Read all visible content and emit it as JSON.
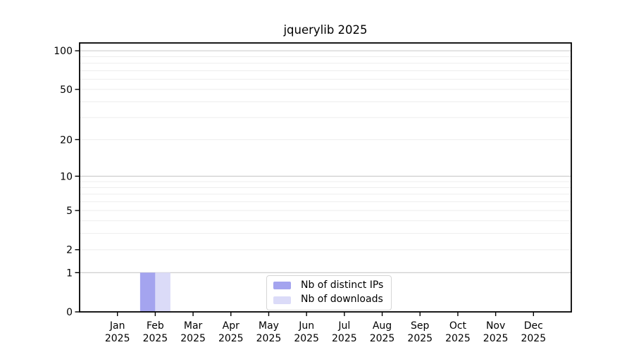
{
  "figure": {
    "background": "#ffffff"
  },
  "chart_data": {
    "type": "bar",
    "title": "jquerylib 2025",
    "categories": [
      "Jan",
      "Feb",
      "Mar",
      "Apr",
      "May",
      "Jun",
      "Jul",
      "Aug",
      "Sep",
      "Oct",
      "Nov",
      "Dec"
    ],
    "x_year_label": "2025",
    "series": [
      {
        "name": "Nb of distinct IPs",
        "color": "#a4a4ef",
        "values": [
          0,
          1,
          0,
          0,
          0,
          0,
          0,
          0,
          0,
          0,
          0,
          0
        ]
      },
      {
        "name": "Nb of downloads",
        "color": "#dbdbf8",
        "values": [
          0,
          1,
          0,
          0,
          0,
          0,
          0,
          0,
          0,
          0,
          0,
          0
        ]
      }
    ],
    "y_axis": {
      "scale": "log1p",
      "range": [
        0,
        115
      ],
      "tick_labels": [
        0,
        1,
        2,
        5,
        10,
        20,
        50,
        100
      ],
      "major_gridlines": [
        1,
        10,
        100
      ],
      "minor_gridlines": [
        2,
        3,
        4,
        5,
        6,
        7,
        8,
        9,
        20,
        30,
        40,
        50,
        60,
        70,
        80,
        90
      ]
    },
    "legend": {
      "position": "bottom-center",
      "entries": [
        {
          "label": "Nb of distinct IPs",
          "color": "#a4a4ef"
        },
        {
          "label": "Nb of downloads",
          "color": "#dbdbf8"
        }
      ]
    },
    "grid": true,
    "colors": {
      "axis": "#000000",
      "major_grid": "#c8c8c8",
      "minor_grid": "#ededed",
      "text": "#000000",
      "legend_border": "#d5d5d5"
    }
  }
}
